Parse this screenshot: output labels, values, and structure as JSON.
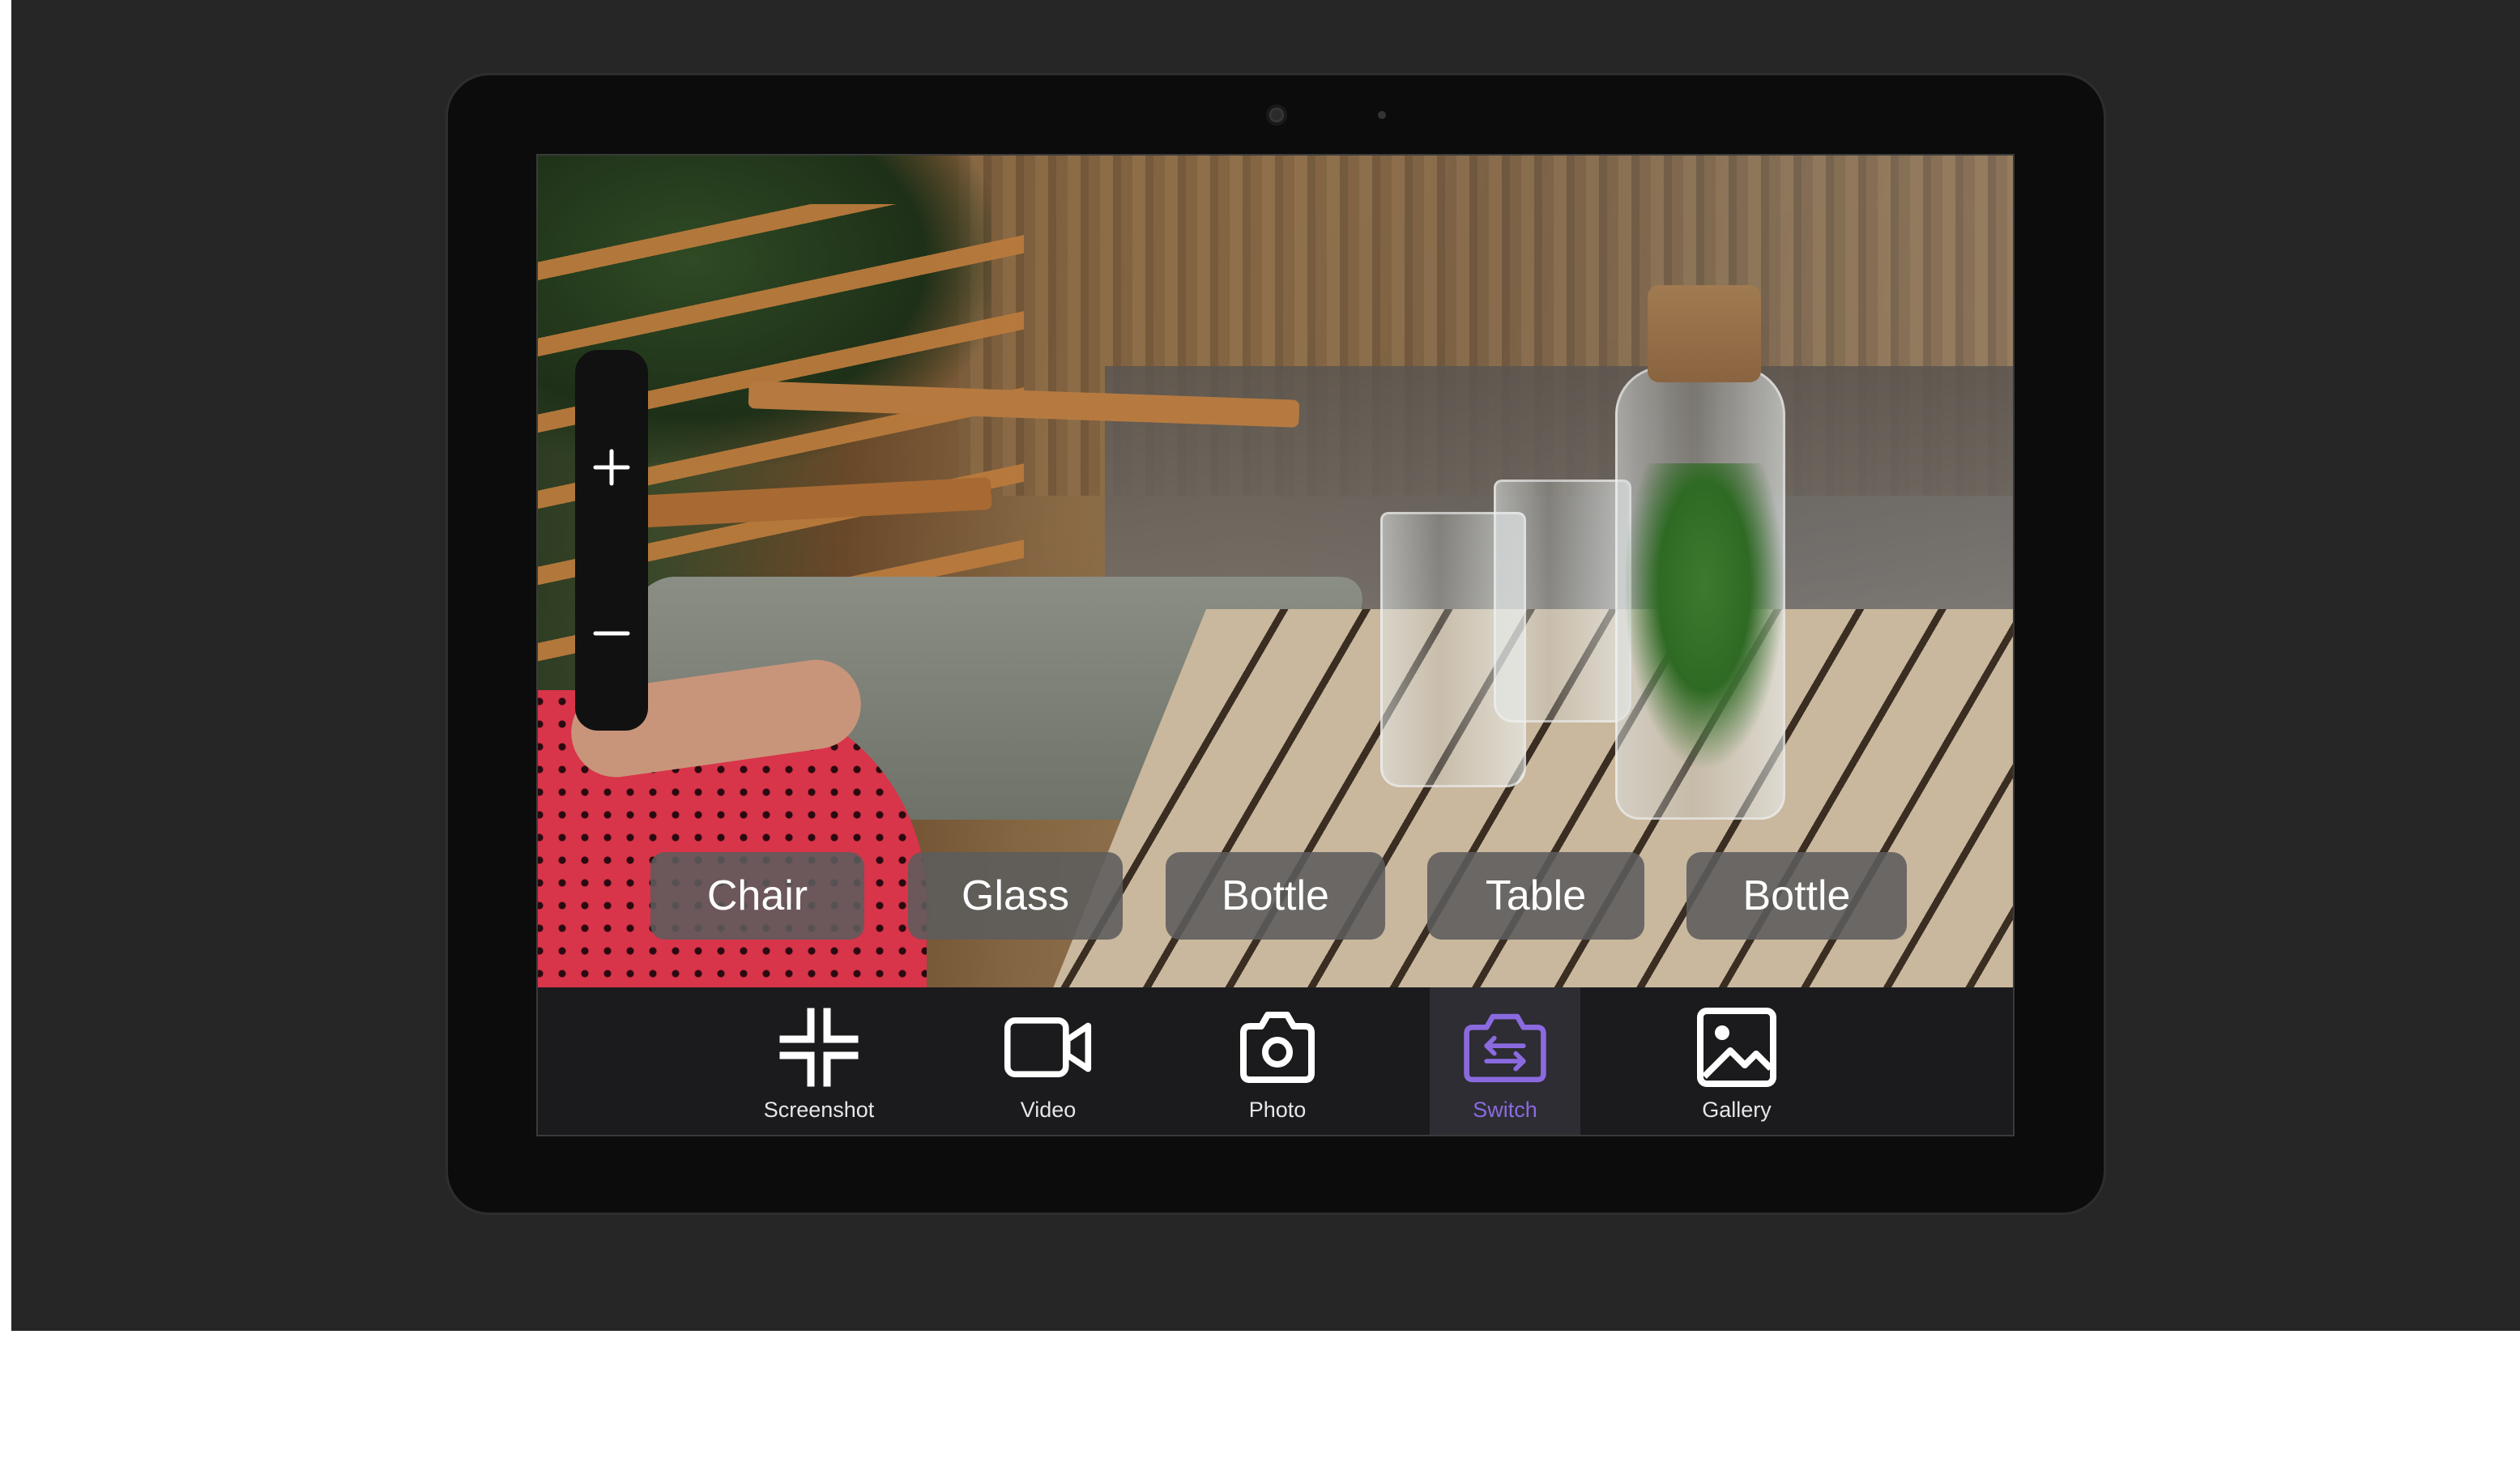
{
  "zoom_controls": {
    "zoom_in_icon": "plus-icon",
    "zoom_out_icon": "minus-icon"
  },
  "detected_objects": [
    {
      "label": "Chair"
    },
    {
      "label": "Glass"
    },
    {
      "label": "Bottle"
    },
    {
      "label": "Table"
    },
    {
      "label": "Bottle"
    }
  ],
  "toolbar": {
    "items": [
      {
        "label": "Screenshot",
        "icon": "screenshot-icon",
        "active": false
      },
      {
        "label": "Video",
        "icon": "video-camera-icon",
        "active": false
      },
      {
        "label": "Photo",
        "icon": "camera-icon",
        "active": false
      },
      {
        "label": "Switch",
        "icon": "switch-camera-icon",
        "active": true
      },
      {
        "label": "Gallery",
        "icon": "gallery-icon",
        "active": false
      }
    ]
  },
  "colors": {
    "accent": "#8b6ae0",
    "backdrop": "#262626",
    "toolbar_bg": "#1b1b1e",
    "chip_bg": "#5c5c5c"
  }
}
